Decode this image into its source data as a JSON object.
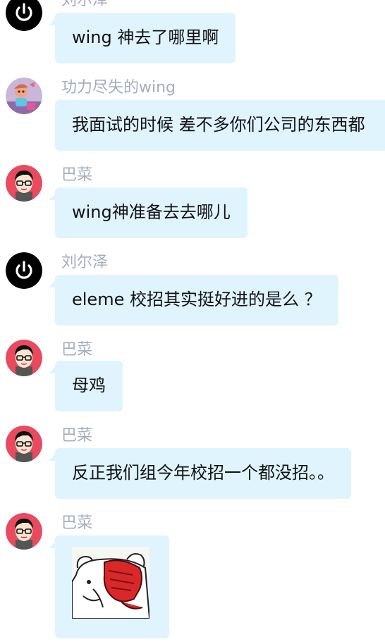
{
  "messages": [
    {
      "sender": "刘尔泽",
      "avatar_icon": "power-icon",
      "text": "wing 神去了哪里啊"
    },
    {
      "sender": "功力尽失的wing",
      "avatar_icon": "cartoon-character-icon",
      "text": "我面试的时候  差不多你们公司的东西都"
    },
    {
      "sender": "巴菜",
      "avatar_icon": "glasses-boy-icon",
      "text": "wing神准备去去哪儿"
    },
    {
      "sender": "刘尔泽",
      "avatar_icon": "power-icon",
      "text": "eleme 校招其实挺好进的是么 ？"
    },
    {
      "sender": "巴菜",
      "avatar_icon": "glasses-boy-icon",
      "text": "母鸡"
    },
    {
      "sender": "巴菜",
      "avatar_icon": "glasses-boy-icon",
      "text": "反正我们组今年校招一个都没招。。"
    },
    {
      "sender": "巴菜",
      "avatar_icon": "glasses-boy-icon",
      "image": "facepalm-bear-sticker"
    }
  ],
  "colors": {
    "bubble": "#dff4fd",
    "name": "#a3adbf",
    "text": "#111111",
    "power_avatar": "#000000",
    "glasses_avatar_bg": "#e84a5f"
  }
}
